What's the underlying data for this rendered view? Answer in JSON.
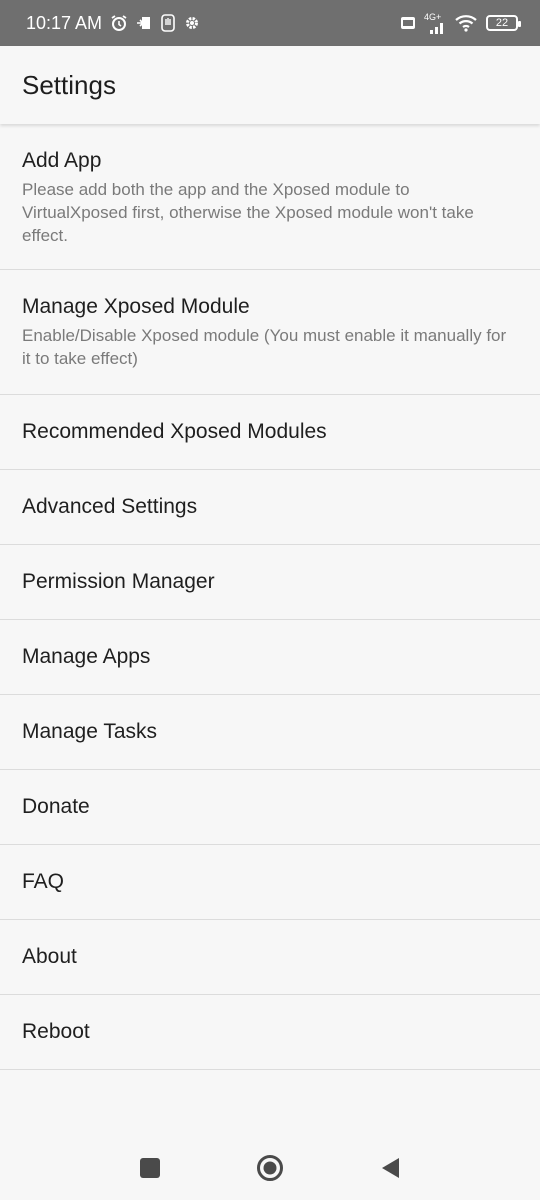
{
  "status_bar": {
    "time": "10:17 AM",
    "left_icons": [
      "alarm-icon",
      "screen-cast-icon",
      "hand-icon",
      "gear-icon"
    ],
    "right_icons": [
      "volte-icon",
      "signal-4g-icon",
      "wifi-icon"
    ],
    "network_label": "4G+",
    "battery_level": "22"
  },
  "app_bar": {
    "title": "Settings"
  },
  "settings": {
    "items": [
      {
        "title": "Add App",
        "summary": "Please add both the app and the Xposed module to VirtualXposed first, otherwise the Xposed module won't take effect."
      },
      {
        "title": "Manage Xposed Module",
        "summary": "Enable/Disable Xposed module (You must enable it manually for it to take effect)"
      },
      {
        "title": "Recommended Xposed Modules"
      },
      {
        "title": "Advanced Settings"
      },
      {
        "title": "Permission Manager"
      },
      {
        "title": "Manage Apps"
      },
      {
        "title": "Manage Tasks"
      },
      {
        "title": "Donate"
      },
      {
        "title": "FAQ"
      },
      {
        "title": "About"
      },
      {
        "title": "Reboot"
      }
    ]
  },
  "nav_bar": {
    "buttons": [
      "recents-icon",
      "home-icon",
      "back-icon"
    ]
  }
}
